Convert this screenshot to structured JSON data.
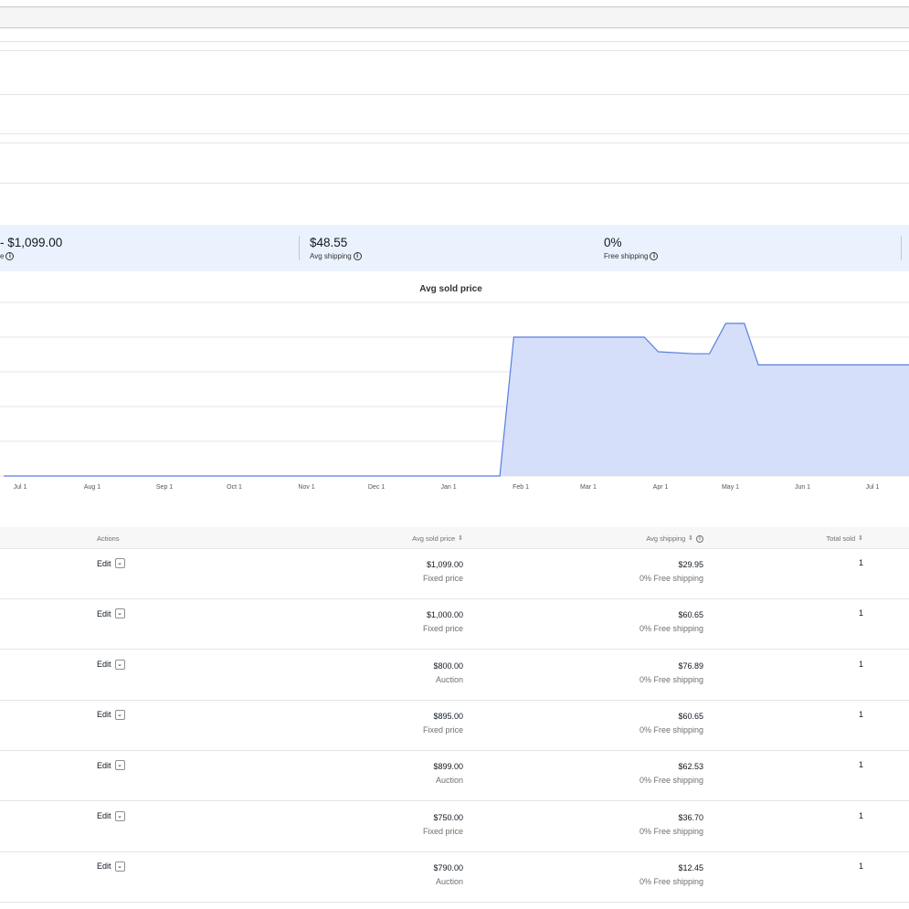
{
  "stats": {
    "price_range": "- $1,099.00",
    "price_range_label": "e",
    "avg_shipping": "$48.55",
    "avg_shipping_label": "Avg shipping",
    "free_shipping": "0%",
    "free_shipping_label": "Free shipping",
    "info_glyph": "i"
  },
  "chart_data": {
    "type": "area",
    "title": "Avg sold price",
    "x_ticks": [
      "Jul 1",
      "Aug 1",
      "Sep 1",
      "Oct 1",
      "Nov 1",
      "Dec 1",
      "Jan 1",
      "Feb 1",
      "Mar 1",
      "Apr 1",
      "May 1",
      "Jun 1",
      "Jul 1"
    ],
    "grid": true,
    "series": [
      {
        "points": [
          {
            "x": "2023-06-24",
            "y": 0
          },
          {
            "x": "2024-01-23",
            "y": 0
          },
          {
            "x": "2024-01-29",
            "y": 1000
          },
          {
            "x": "2024-03-25",
            "y": 1000
          },
          {
            "x": "2024-03-31",
            "y": 895
          },
          {
            "x": "2024-04-15",
            "y": 880
          },
          {
            "x": "2024-04-22",
            "y": 880
          },
          {
            "x": "2024-04-29",
            "y": 1099
          },
          {
            "x": "2024-05-07",
            "y": 1099
          },
          {
            "x": "2024-05-13",
            "y": 800
          },
          {
            "x": "2024-07-15",
            "y": 800
          }
        ]
      }
    ],
    "y_range": [
      0,
      1250
    ],
    "color": "#5a7de0",
    "fill": "#d5dffa"
  },
  "table": {
    "headers": {
      "actions": "Actions",
      "avg_sold_price": "Avg sold price",
      "avg_shipping": "Avg shipping",
      "total_sold": "Total sold"
    },
    "sort_glyph": "⇕",
    "edit_label": "Edit",
    "chevron_glyph": "⌄",
    "rows": [
      {
        "price": "$1,099.00",
        "format": "Fixed price",
        "shipping": "$29.95",
        "free": "0% Free shipping",
        "sold": "1"
      },
      {
        "price": "$1,000.00",
        "format": "Fixed price",
        "shipping": "$60.65",
        "free": "0% Free shipping",
        "sold": "1"
      },
      {
        "price": "$800.00",
        "format": "Auction",
        "shipping": "$76.89",
        "free": "0% Free shipping",
        "sold": "1"
      },
      {
        "price": "$895.00",
        "format": "Fixed price",
        "shipping": "$60.65",
        "free": "0% Free shipping",
        "sold": "1"
      },
      {
        "price": "$899.00",
        "format": "Auction",
        "shipping": "$62.53",
        "free": "0% Free shipping",
        "sold": "1"
      },
      {
        "price": "$750.00",
        "format": "Fixed price",
        "shipping": "$36.70",
        "free": "0% Free shipping",
        "sold": "1"
      },
      {
        "price": "$790.00",
        "format": "Auction",
        "shipping": "$12.45",
        "free": "0% Free shipping",
        "sold": "1"
      }
    ]
  }
}
